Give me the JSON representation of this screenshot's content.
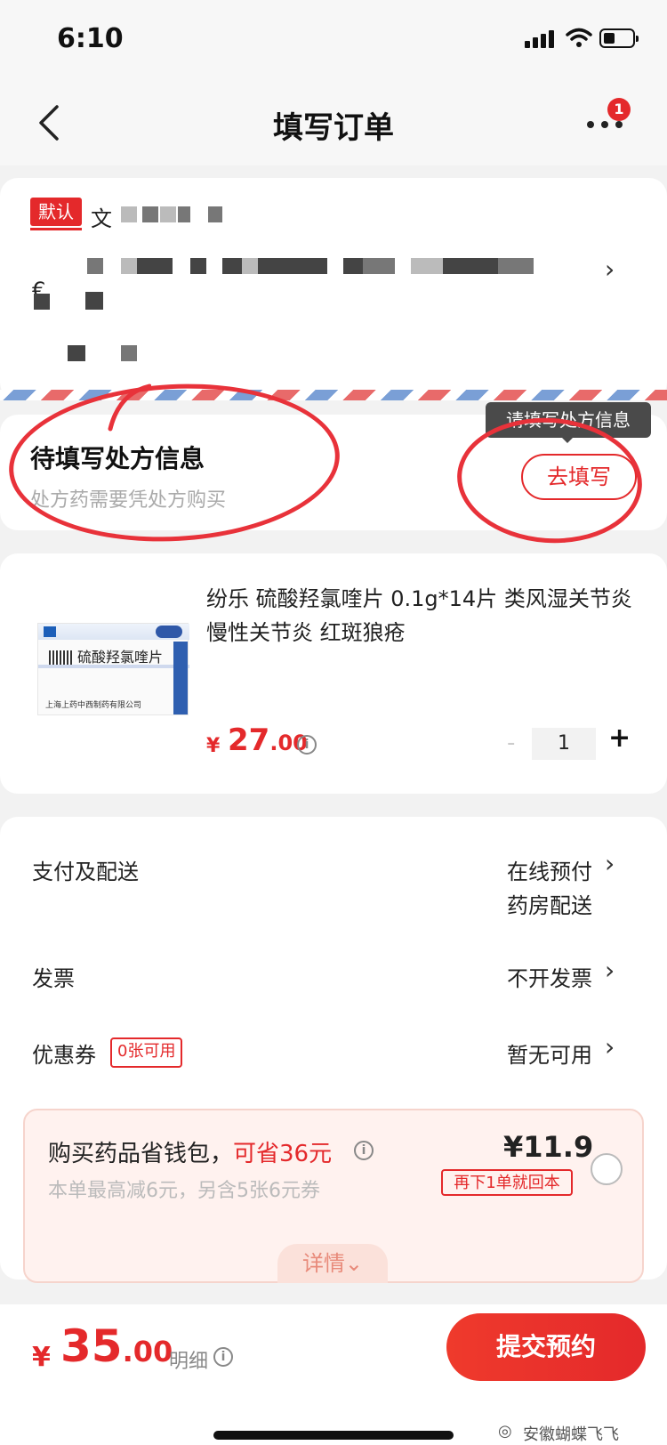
{
  "status_bar": {
    "time": "6:10"
  },
  "nav": {
    "title": "填写订单",
    "badge_count": "1"
  },
  "address": {
    "default_tag": "默认",
    "name_initial": "文",
    "line2_initial": "€",
    "chevron": "›"
  },
  "prescription": {
    "title": "待填写处方信息",
    "subtitle": "处方药需要凭处方购买",
    "tooltip": "请填写处方信息",
    "button": "去填写"
  },
  "product": {
    "title": "纷乐 硫酸羟氯喹片 0.1g*14片 类风湿关节炎 慢性关节炎 红斑狼疮",
    "image_name": "硫酸羟氯喹片",
    "image_maker": "上海上药中西制药有限公司",
    "currency": "¥",
    "price_int": "27",
    "price_dec": ".00",
    "info": "i",
    "minus": "-",
    "quantity": "1",
    "plus": "+"
  },
  "rows": {
    "payment_label": "支付及配送",
    "payment_value_1": "在线预付",
    "payment_value_2": "药房配送",
    "invoice_label": "发票",
    "invoice_value": "不开发票",
    "coupon_label": "优惠券",
    "coupon_tag": "0张可用",
    "coupon_value": "暂无可用",
    "chevron": "›"
  },
  "savings": {
    "title_prefix": "购买药品省钱包，",
    "title_highlight": "可省36元",
    "subtitle": "本单最高减6元，另含5张6元券",
    "price": "¥11.9",
    "badge": "再下1单就回本",
    "detail": "详情⌄"
  },
  "footer": {
    "currency": "¥",
    "total_int": "35",
    "total_dec": ".00",
    "detail": "明细",
    "submit": "提交预约"
  },
  "watermark": {
    "text": "安徽蝴蝶飞飞",
    "icon": "wechat-icon"
  },
  "colors": {
    "accent": "#e4292b",
    "annotation": "#e8323a"
  }
}
